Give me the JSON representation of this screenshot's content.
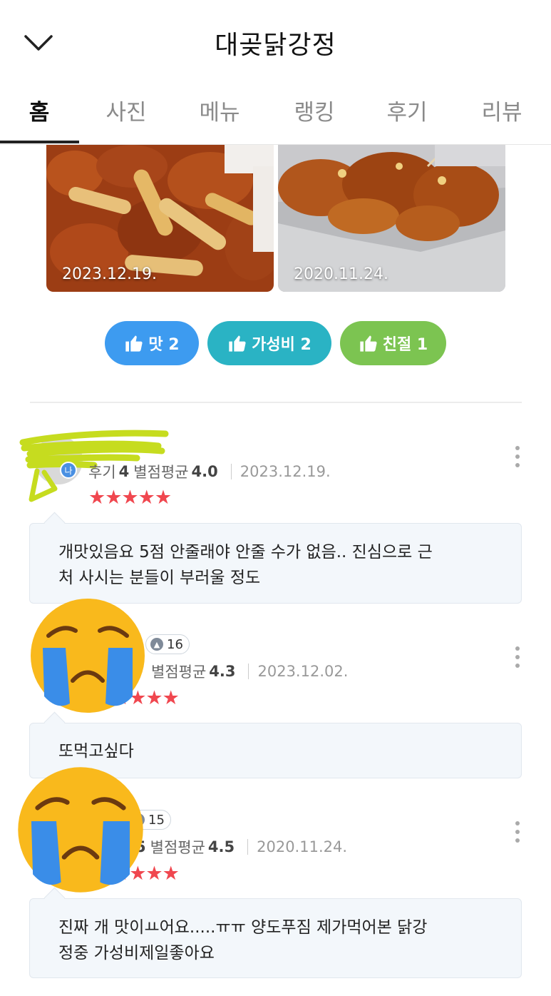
{
  "header": {
    "title": "대곶닭강정",
    "back_icon": "chevron-down-icon"
  },
  "tabs": [
    {
      "label": "홈",
      "active": true
    },
    {
      "label": "사진",
      "active": false
    },
    {
      "label": "메뉴",
      "active": false
    },
    {
      "label": "랭킹",
      "active": false
    },
    {
      "label": "후기",
      "active": false
    },
    {
      "label": "리뷰",
      "active": false
    }
  ],
  "photos": [
    {
      "date": "2023.12.19."
    },
    {
      "date": "2020.11.24."
    }
  ],
  "chips": [
    {
      "label": "맛 2",
      "color": "#3d9bf0",
      "icon": "thumbs-up-icon"
    },
    {
      "label": "가성비 2",
      "color": "#2ab3c4",
      "icon": "thumbs-up-icon"
    },
    {
      "label": "친절 1",
      "color": "#7cc451",
      "icon": "thumbs-up-icon"
    }
  ],
  "reviews": [
    {
      "reviewer_badge": "나",
      "review_count_label": "후기",
      "review_count": "4",
      "avg_label": "별점평균",
      "avg": "4.0",
      "date": "2023.12.19.",
      "stars": "★★★★★",
      "text_line1": "개맛있음요 5점 안줄래야 안줄 수가 없음.. 진심으로 근",
      "text_line2": "처 사시는 분들이 부러울 정도"
    },
    {
      "level": "16",
      "avg_label": "별점평균",
      "avg": "4.3",
      "date": "2023.12.02.",
      "stars": "★★★★",
      "text_line1": "또먹고싶다"
    },
    {
      "level": "15",
      "count_fragment": "5",
      "avg_label": "별점평균",
      "avg": "4.5",
      "date": "2020.11.24.",
      "stars": "★★★★",
      "text_line1": "진짜 개 맛이ㅛ어요.....ㅠㅠ 양도푸짐 제가먹어본 닭강",
      "text_line2": "정중 가성비제일좋아요"
    }
  ],
  "colors": {
    "star": "#f0474f",
    "bubble_bg": "#f3f7fb",
    "emoji_face": "#f9b91c",
    "emoji_tear": "#3a8de8",
    "scribble": "#c6dc1f"
  }
}
